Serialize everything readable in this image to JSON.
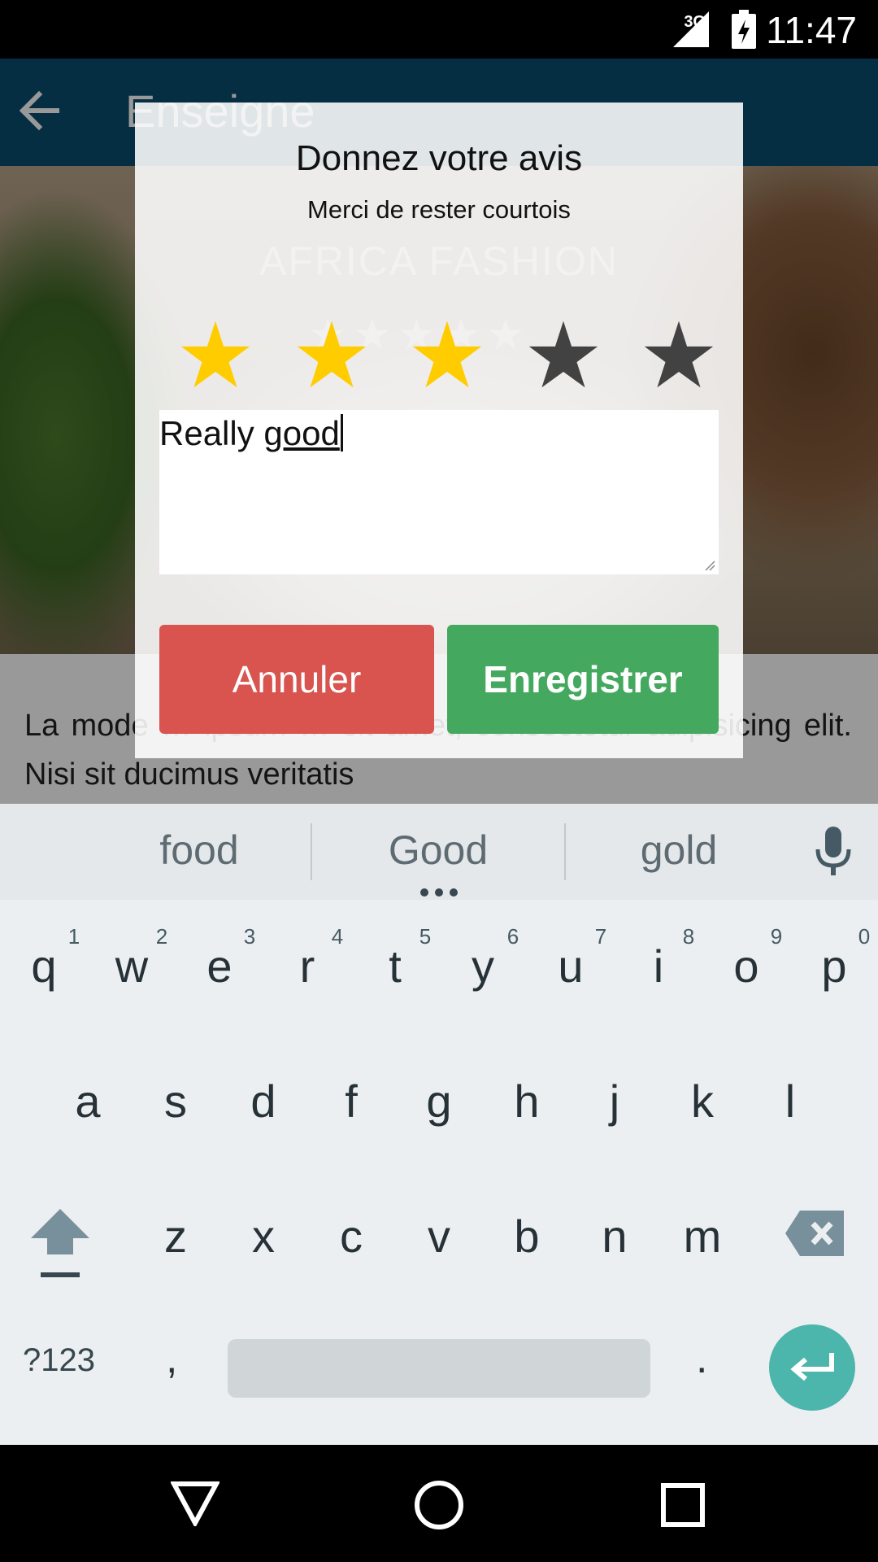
{
  "status_bar": {
    "network": "3G",
    "time": "11:47"
  },
  "app_bar": {
    "title": "Enseigne"
  },
  "hero": {
    "caption": "AFRICA FASHION",
    "stars": "★★★★★"
  },
  "body_text": "La mode … ipsum … sit amet, consectetur adipisicing elit. Nisi sit ducimus veritatis",
  "dialog": {
    "title": "Donnez votre avis",
    "subtitle": "Merci de rester courtois",
    "rating": {
      "value": 3,
      "max": 5
    },
    "review": {
      "prefix": "Really ",
      "underlined_word": "good"
    },
    "cancel_label": "Annuler",
    "save_label": "Enregistrer"
  },
  "keyboard": {
    "suggestions": [
      "food",
      "Good",
      "gold"
    ],
    "row1": [
      {
        "key": "q",
        "num": "1"
      },
      {
        "key": "w",
        "num": "2"
      },
      {
        "key": "e",
        "num": "3"
      },
      {
        "key": "r",
        "num": "4"
      },
      {
        "key": "t",
        "num": "5"
      },
      {
        "key": "y",
        "num": "6"
      },
      {
        "key": "u",
        "num": "7"
      },
      {
        "key": "i",
        "num": "8"
      },
      {
        "key": "o",
        "num": "9"
      },
      {
        "key": "p",
        "num": "0"
      }
    ],
    "row2": [
      "a",
      "s",
      "d",
      "f",
      "g",
      "h",
      "j",
      "k",
      "l"
    ],
    "row3": [
      "z",
      "x",
      "c",
      "v",
      "b",
      "n",
      "m"
    ],
    "symbols_label": "?123",
    "comma": ",",
    "period": "."
  },
  "colors": {
    "app_bar": "#0a4e70",
    "star_filled": "#ffcc00",
    "star_empty": "#424242",
    "cancel": "#d9534f",
    "save": "#44a95f",
    "enter": "#4db6ac"
  },
  "icons": [
    "back-arrow-icon",
    "signal-icon",
    "battery-charging-icon",
    "mic-icon",
    "shift-icon",
    "backspace-icon",
    "enter-icon",
    "nav-back-icon",
    "nav-home-icon",
    "nav-recents-icon",
    "more-dots-icon"
  ]
}
